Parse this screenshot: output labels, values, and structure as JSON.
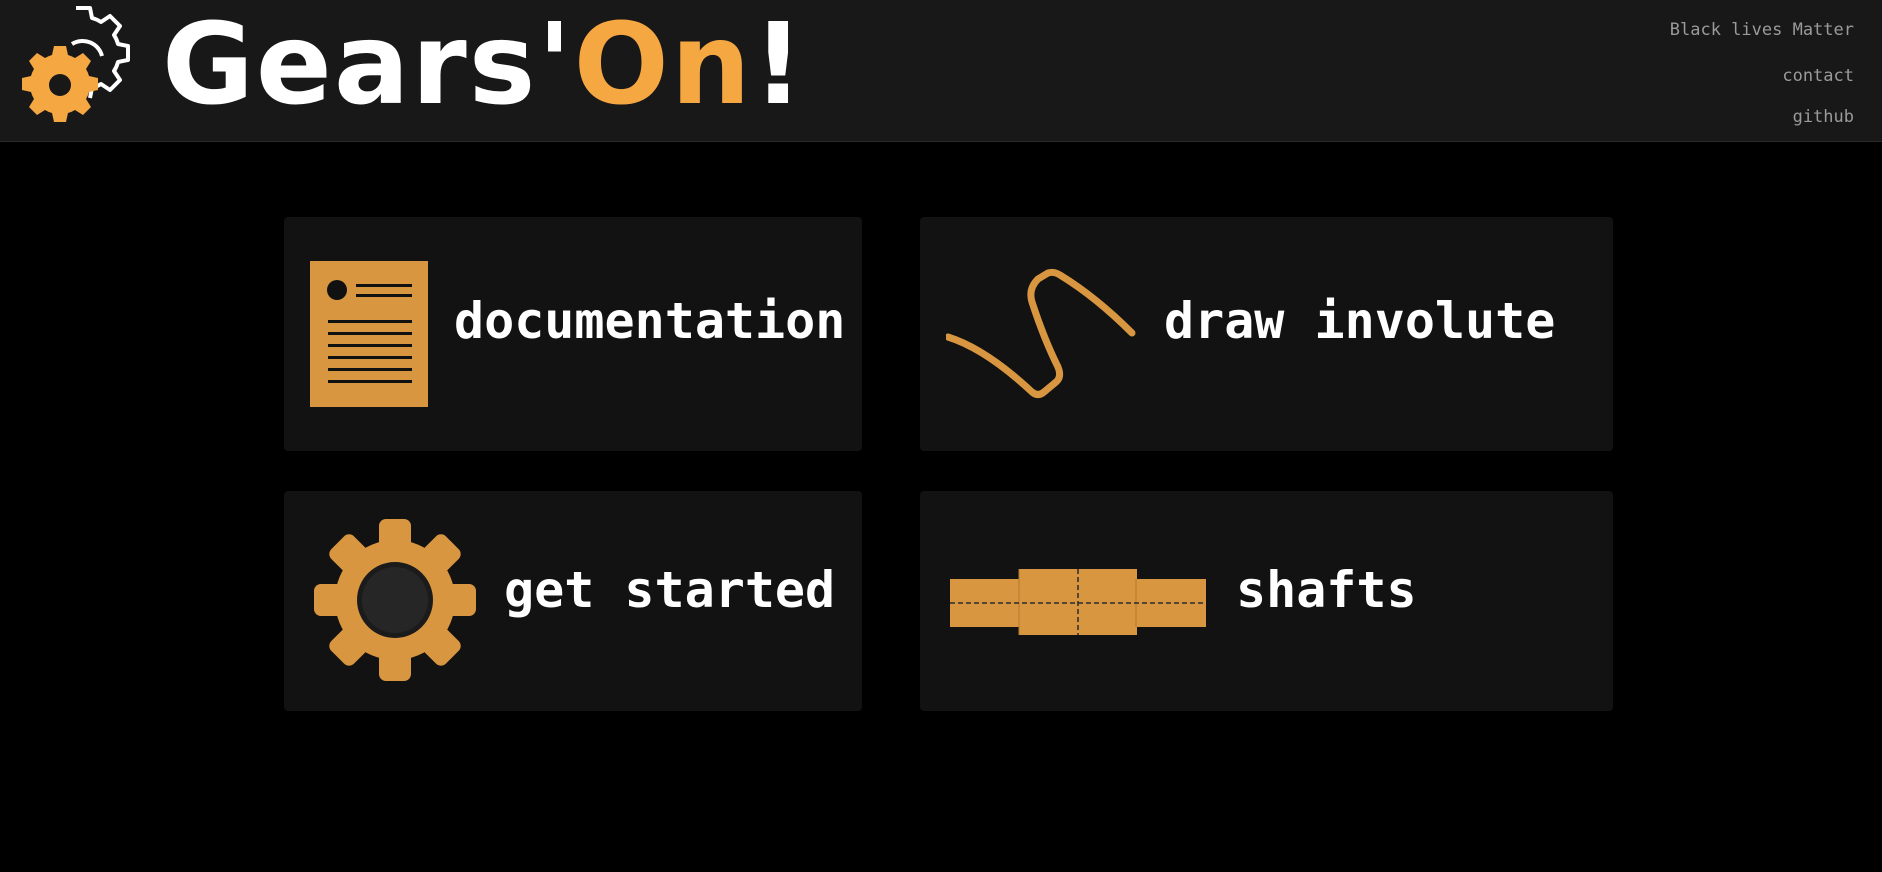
{
  "header": {
    "logo": {
      "icon": "gears-icon",
      "text_main": "Gears'",
      "text_accent": "On",
      "text_end": "!"
    },
    "nav": {
      "blm_label": "Black lives Matter",
      "contact_label": "contact",
      "github_label": "github"
    }
  },
  "cards": [
    {
      "label": "documentation",
      "icon": "document-icon"
    },
    {
      "label": "draw involute",
      "icon": "involute-curve-icon"
    },
    {
      "label": "get started",
      "icon": "gear-icon"
    },
    {
      "label": "shafts",
      "icon": "shaft-icon"
    }
  ],
  "colors": {
    "accent": "#f5a742",
    "icon_orange": "#d99640",
    "header_bg": "#181818",
    "card_bg": "#121212",
    "page_bg": "#000000",
    "nav_text": "#9a9a9a"
  }
}
